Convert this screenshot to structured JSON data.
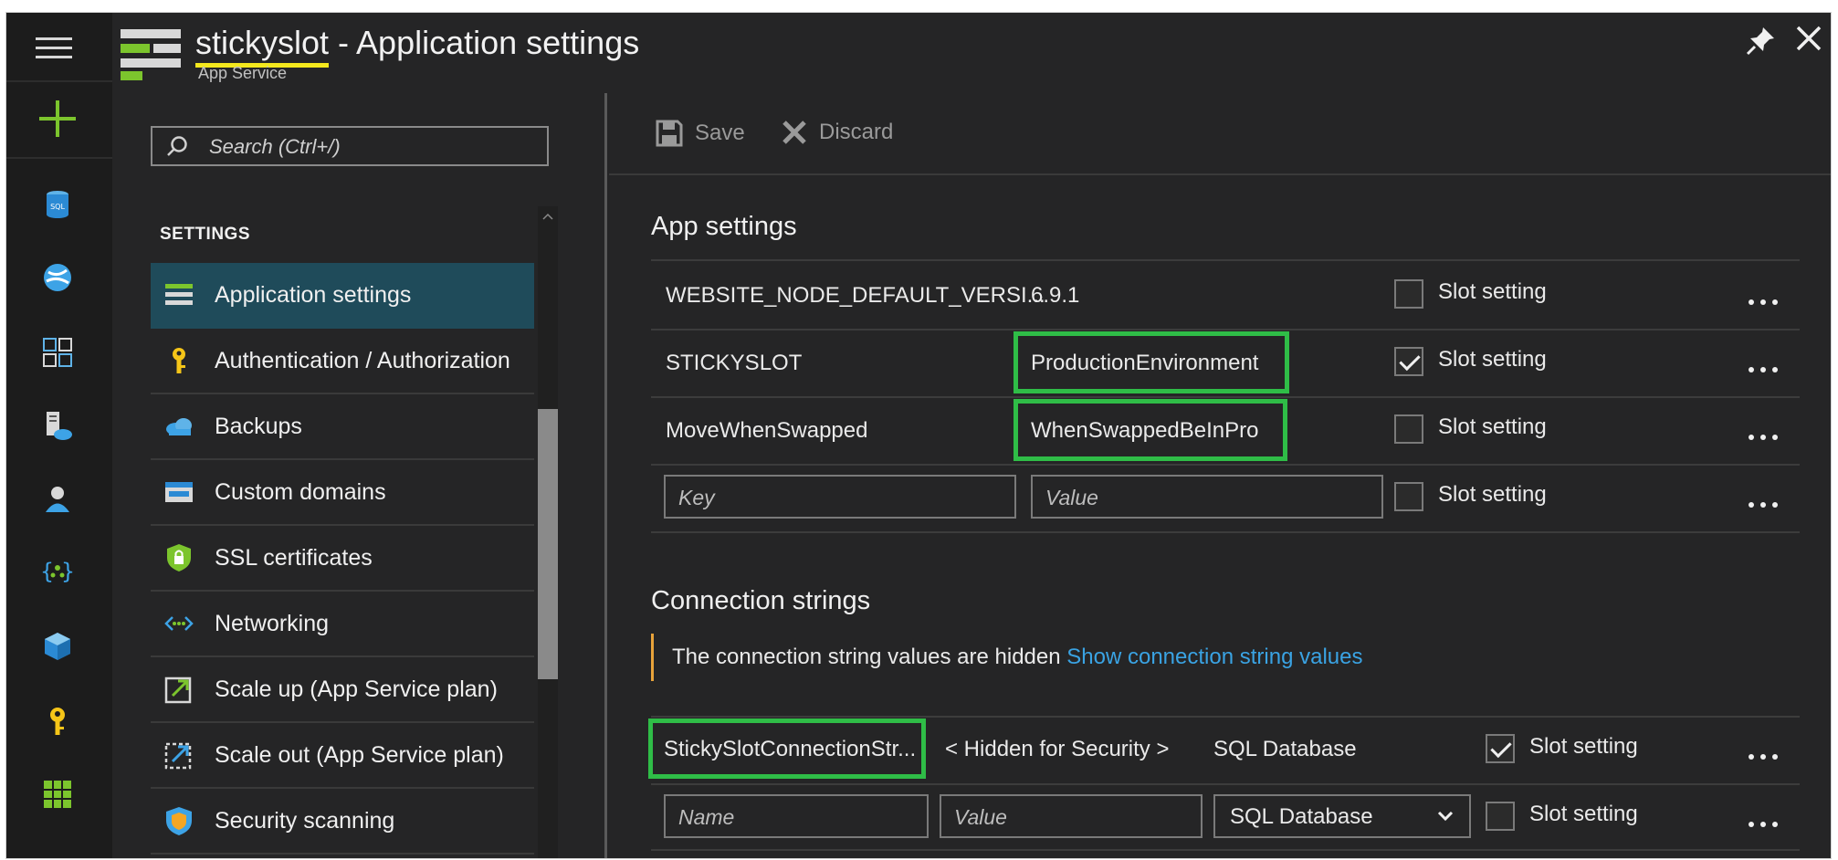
{
  "header": {
    "resource_name": "stickyslot",
    "title_suffix": " - Application settings",
    "subtitle": "App Service"
  },
  "search": {
    "placeholder": "Search (Ctrl+/)"
  },
  "menu": {
    "section": "SETTINGS",
    "items": [
      {
        "label": "Application settings",
        "icon": "settings-list-icon",
        "active": true
      },
      {
        "label": "Authentication / Authorization",
        "icon": "key-icon"
      },
      {
        "label": "Backups",
        "icon": "cloud-backup-icon"
      },
      {
        "label": "Custom domains",
        "icon": "www-icon"
      },
      {
        "label": "SSL certificates",
        "icon": "shield-lock-icon"
      },
      {
        "label": "Networking",
        "icon": "networking-icon"
      },
      {
        "label": "Scale up (App Service plan)",
        "icon": "scale-up-icon"
      },
      {
        "label": "Scale out (App Service plan)",
        "icon": "scale-out-icon"
      },
      {
        "label": "Security scanning",
        "icon": "security-shield-icon"
      }
    ]
  },
  "toolbar": {
    "save_label": "Save",
    "discard_label": "Discard"
  },
  "app_settings": {
    "heading": "App settings",
    "slot_label": "Slot setting",
    "rows": [
      {
        "key": "WEBSITE_NODE_DEFAULT_VERSI...",
        "value": "6.9.1",
        "slot": false
      },
      {
        "key": "STICKYSLOT",
        "value": "ProductionEnvironment",
        "slot": true
      },
      {
        "key": "MoveWhenSwapped",
        "value": "WhenSwappedBeInPro",
        "slot": false
      }
    ],
    "new_key_placeholder": "Key",
    "new_value_placeholder": "Value"
  },
  "connection_strings": {
    "heading": "Connection strings",
    "notice": "The connection string values are hidden ",
    "notice_link": "Show connection string values",
    "rows": [
      {
        "name": "StickySlotConnectionStr...",
        "value": "< Hidden for Security >",
        "type": "SQL Database",
        "slot": true
      }
    ],
    "new_name_placeholder": "Name",
    "new_value_placeholder": "Value",
    "new_type": "SQL Database"
  },
  "colors": {
    "highlight": "#2fbd47",
    "underline": "#f4e81d",
    "active_item": "#1f4b5a",
    "link": "#3aa3e3",
    "notice_bar": "#e8a33a"
  }
}
